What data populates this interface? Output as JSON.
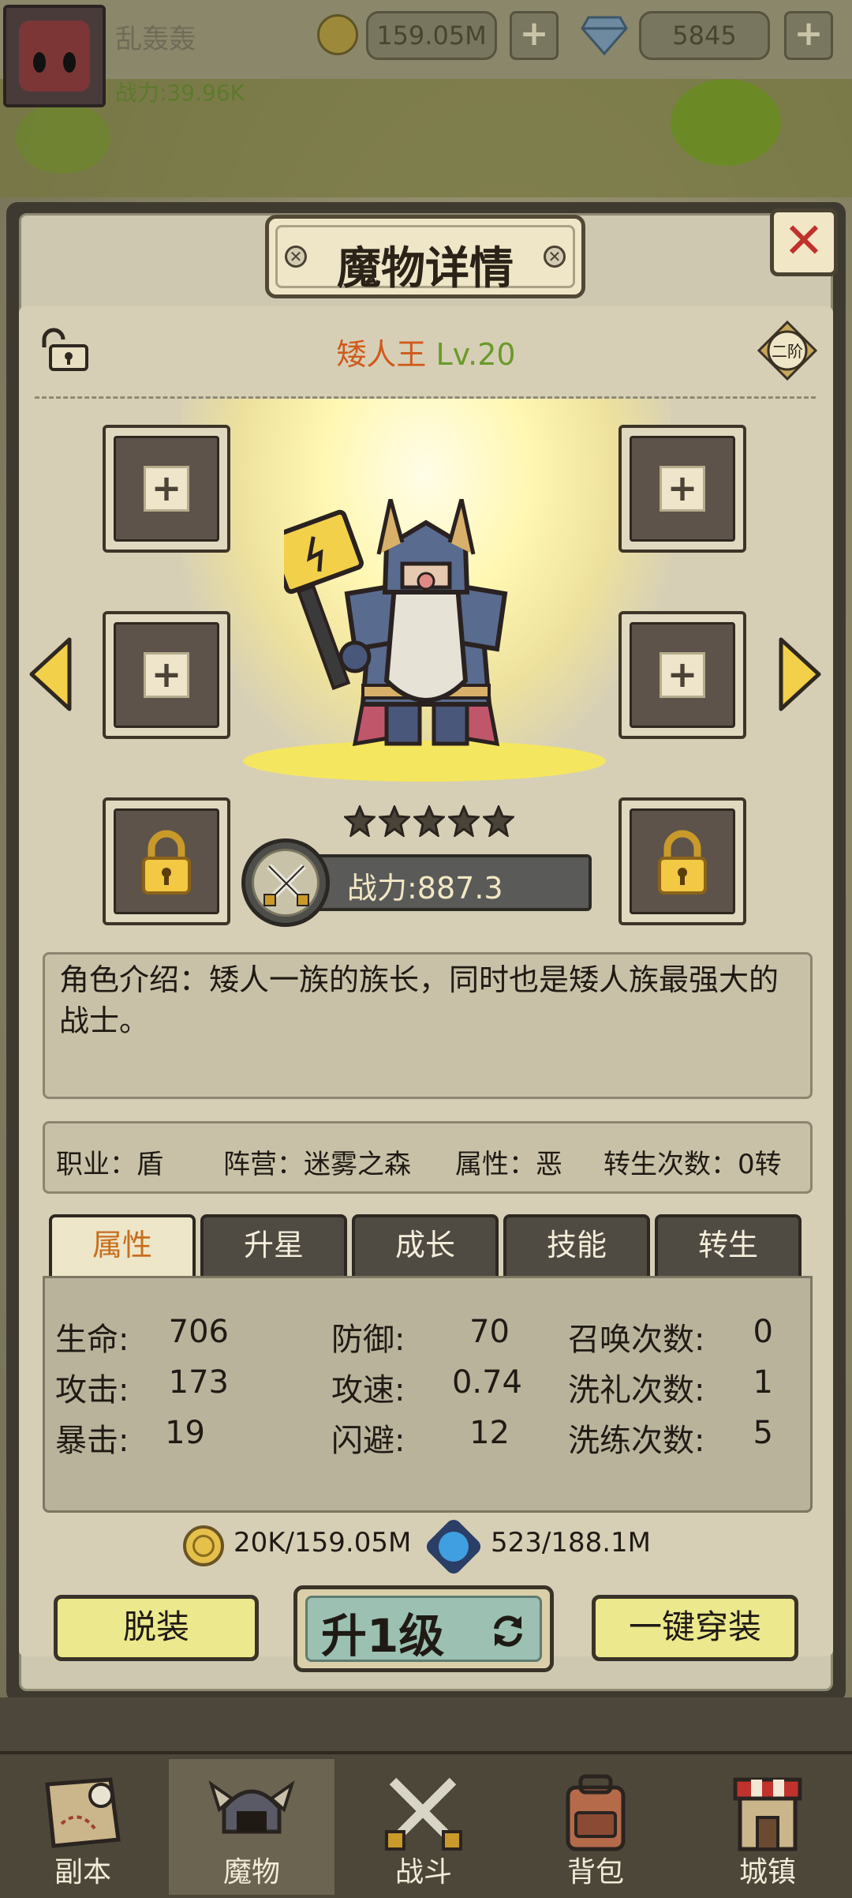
{
  "header": {
    "player_name": "乱轰轰",
    "power": "战力:39.96K",
    "gold": "159.05M",
    "gems": "5845",
    "plus": "+"
  },
  "panel": {
    "title": "魔物详情",
    "close": "✕",
    "rank_badge": "二阶",
    "monster_name": "矮人王",
    "monster_level": "Lv.20",
    "stars": 5,
    "power": "战力:887.3",
    "description": "角色介绍：矮人一族的族长，同时也是矮人族最强大的战士。",
    "info": {
      "class": "职业：盾",
      "faction": "阵营：迷雾之森",
      "attribute": "属性：恶",
      "rebirth": "转生次数：0转"
    },
    "tabs": [
      "属性",
      "升星",
      "成长",
      "技能",
      "转生"
    ],
    "active_tab": "属性",
    "stats": [
      {
        "label": "生命:",
        "value": "706"
      },
      {
        "label": "攻击:",
        "value": "173"
      },
      {
        "label": "暴击:",
        "value": "19"
      },
      {
        "label": "防御:",
        "value": "70"
      },
      {
        "label": "攻速:",
        "value": "0.74"
      },
      {
        "label": "闪避:",
        "value": "12"
      },
      {
        "label": "召唤次数:",
        "value": "0"
      },
      {
        "label": "洗礼次数:",
        "value": "1"
      },
      {
        "label": "洗练次数:",
        "value": "5"
      }
    ],
    "cost_gold": "20K/159.05M",
    "cost_orb": "523/188.1M",
    "buttons": {
      "unequip": "脱装",
      "level_up": "升1级",
      "equip_all": "一键穿装"
    }
  },
  "nav": {
    "items": [
      "副本",
      "魔物",
      "战斗",
      "背包",
      "城镇"
    ],
    "active": "魔物"
  },
  "colors": {
    "accent_orange": "#d05a1c",
    "level_green": "#6a9a2a",
    "button_yellow": "#ece88d",
    "close_red": "#c0322c"
  }
}
